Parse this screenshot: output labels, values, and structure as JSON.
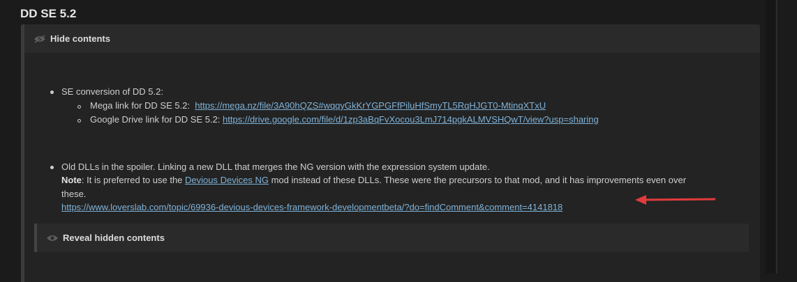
{
  "page_title": "DD SE 5.2",
  "spoiler": {
    "header_label": "Hide contents",
    "bullet1": {
      "text": "SE conversion of DD 5.2:",
      "sub1_label": "Mega link for DD SE 5.2:",
      "sub1_link": "https://mega.nz/file/3A90hQZS#wqqyGkKrYGPGFfPiluHfSmyTL5RqHJGT0-MtinqXTxU",
      "sub2_label": "Google Drive link for DD SE 5.2:",
      "sub2_link": "https://drive.google.com/file/d/1zp3aBqFvXocou3LmJ714pgkALMVSHQwT/view?usp=sharing"
    },
    "bullet2": {
      "text": "Old DLLs in the spoiler. Linking a new DLL that merges the NG version with the expression system update.",
      "note_label": "Note",
      "note_text_before": ": It is preferred to use the ",
      "note_link": "Devious Devices NG",
      "note_text_after": " mod instead of these DLLs. These were the precursors to that mod, and it has improvements even over",
      "note_text_wrap": "these.",
      "link": "https://www.loverslab.com/topic/69936-devious-devices-framework-developmentbeta/?do=findComment&comment=4141818"
    },
    "reveal_label": "Reveal hidden contents"
  },
  "colors": {
    "background": "#1b1b1b",
    "panel": "#232323",
    "link": "#7fb3d9",
    "arrow": "#e23b3b"
  },
  "icons": [
    "eye-icon",
    "arrow-annotation"
  ]
}
